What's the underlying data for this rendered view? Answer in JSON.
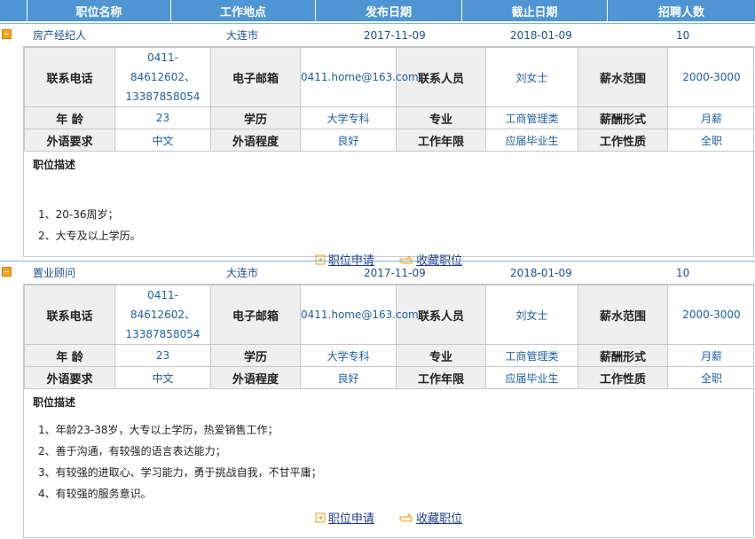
{
  "header": {
    "columns": [
      "职位名称",
      "工作地点",
      "发布日期",
      "截止日期",
      "招聘人数"
    ]
  },
  "labels": {
    "phone": "联系电话",
    "email": "电子邮箱",
    "contact": "联系人员",
    "salary": "薪水范围",
    "age": "年 龄",
    "education": "学历",
    "major": "专业",
    "salary_form": "薪酬形式",
    "language": "外语要求",
    "language_level": "外语程度",
    "experience": "工作年限",
    "job_type": "工作性质",
    "desc_title": "职位描述",
    "apply": "职位申请",
    "favorite": "收藏职位"
  },
  "jobs": [
    {
      "title": "房产经纪人",
      "location": "大连市",
      "publish_date": "2017-11-09",
      "deadline": "2018-01-09",
      "headcount": "10",
      "phone1": "0411-84612602、",
      "phone2": "13387858054",
      "email": "0411.home@163.com",
      "contact": "刘女士",
      "salary": "2000-3000",
      "age": "23",
      "education": "大学专科",
      "major": "工商管理类",
      "salary_form": "月薪",
      "language": "中文",
      "language_level": "良好",
      "experience": "应届毕业生",
      "job_type": "全职",
      "description": [
        "1、20-36周岁；",
        "2、大专及以上学历。"
      ]
    },
    {
      "title": "置业顾问",
      "location": "大连市",
      "publish_date": "2017-11-09",
      "deadline": "2018-01-09",
      "headcount": "10",
      "phone1": "0411-84612602、",
      "phone2": "13387858054",
      "email": "0411.home@163.com",
      "contact": "刘女士",
      "salary": "2000-3000",
      "age": "23",
      "education": "大学专科",
      "major": "工商管理类",
      "salary_form": "月薪",
      "language": "中文",
      "language_level": "良好",
      "experience": "应届毕业生",
      "job_type": "全职",
      "description": [
        "1、年龄23-38岁，大专以上学历，热爱销售工作；",
        "2、善于沟通，有较强的语言表达能力；",
        "3、有较强的进取心、学习能力，勇于挑战自我，不甘平庸；",
        "4、有较强的服务意识。"
      ]
    }
  ]
}
